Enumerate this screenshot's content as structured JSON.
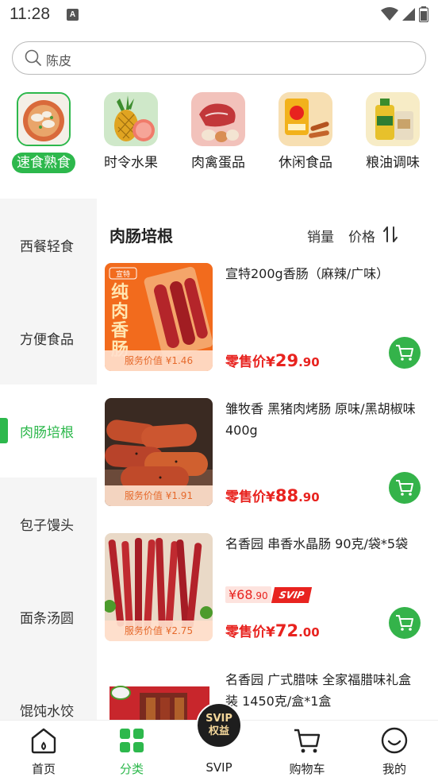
{
  "status_bar": {
    "time": "11:28",
    "notif_letter": "A"
  },
  "search": {
    "placeholder": "陈皮"
  },
  "categories": [
    {
      "label": "速食熟食",
      "active": true,
      "icon": "dumpling-bowl-icon"
    },
    {
      "label": "时令水果",
      "active": false,
      "icon": "pineapple-icon"
    },
    {
      "label": "肉禽蛋品",
      "active": false,
      "icon": "meat-eggs-icon"
    },
    {
      "label": "休闲食品",
      "active": false,
      "icon": "chips-icon"
    },
    {
      "label": "粮油调味",
      "active": false,
      "icon": "oil-rice-icon"
    }
  ],
  "sidebar": {
    "items": [
      {
        "label": "西餐轻食"
      },
      {
        "label": "方便食品"
      },
      {
        "label": "肉肠培根",
        "active": true
      },
      {
        "label": "包子馒头"
      },
      {
        "label": "面条汤圆"
      },
      {
        "label": "馄饨水饺"
      }
    ]
  },
  "list": {
    "title": "肉肠培根",
    "sort_sales": "销量",
    "sort_price": "价格"
  },
  "products": [
    {
      "name": "宣特200g香肠（麻辣/广味）",
      "service_value": "服务价值 ¥1.46",
      "price_prefix": "零售价¥",
      "price_int": "29",
      "price_dec": ".90",
      "image_text": "纯肉香肠",
      "image_brand": "宣特"
    },
    {
      "name": "雏牧香 黑猪肉烤肠 原味/黑胡椒味 400g",
      "service_value": "服务价值 ¥1.91",
      "price_prefix": "零售价¥",
      "price_int": "88",
      "price_dec": ".90"
    },
    {
      "name": "名香园 串香水晶肠 90克/袋*5袋",
      "service_value": "服务价值 ¥2.75",
      "svip_price_int": "¥68",
      "svip_price_dec": ".90",
      "svip_tag": "SVIP",
      "price_prefix": "零售价¥",
      "price_int": "72",
      "price_dec": ".00"
    },
    {
      "name": "名香园 广式腊味 全家福腊味礼盒装 1450克/盒*1盒"
    }
  ],
  "bottom_nav": {
    "home": "首页",
    "category": "分类",
    "svip_badge_top": "SVIP",
    "svip_badge_bottom": "权益",
    "svip": "SVIP",
    "cart": "购物车",
    "mine": "我的"
  },
  "colors": {
    "accent_green": "#2db84c",
    "price_red": "#e8231f",
    "service_orange": "#e66a2c"
  }
}
